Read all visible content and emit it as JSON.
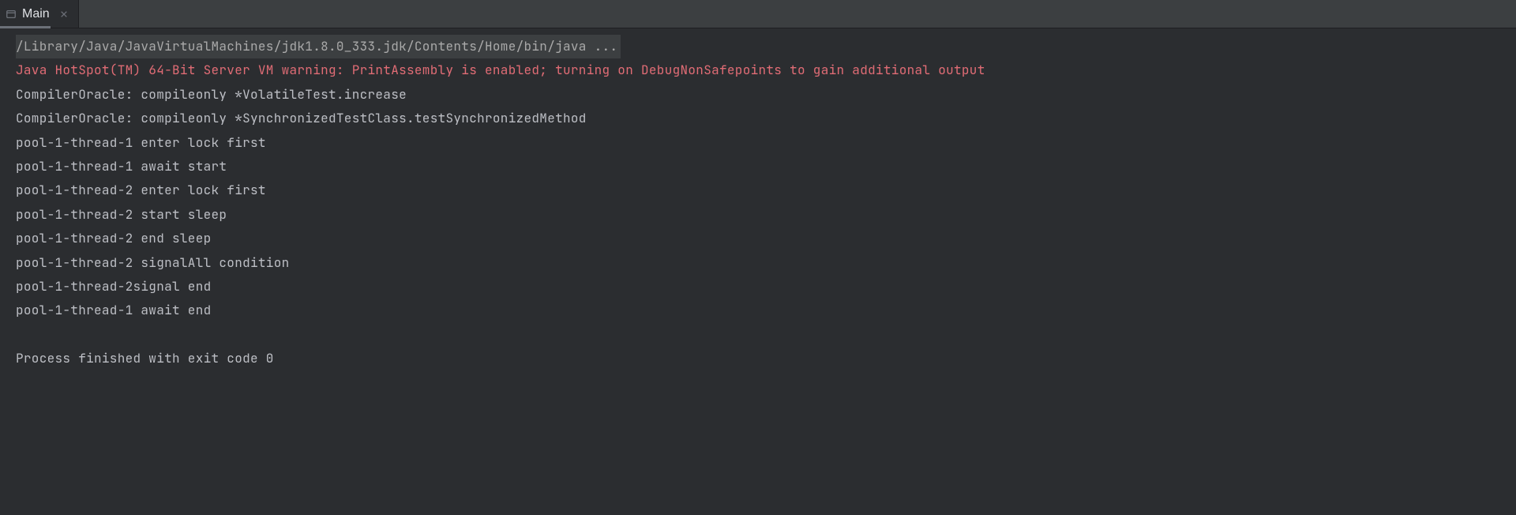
{
  "tab": {
    "label": "Main"
  },
  "console": {
    "command": "/Library/Java/JavaVirtualMachines/jdk1.8.0_333.jdk/Contents/Home/bin/java ...",
    "warning": "Java HotSpot(TM) 64-Bit Server VM warning: PrintAssembly is enabled; turning on DebugNonSafepoints to gain additional output",
    "lines": [
      "CompilerOracle: compileonly *VolatileTest.increase",
      "CompilerOracle: compileonly *SynchronizedTestClass.testSynchronizedMethod",
      "pool-1-thread-1 enter lock first",
      "pool-1-thread-1 await start",
      "pool-1-thread-2 enter lock first",
      "pool-1-thread-2 start sleep",
      "pool-1-thread-2 end sleep",
      "pool-1-thread-2 signalAll condition",
      "pool-1-thread-2signal end",
      "pool-1-thread-1 await end"
    ],
    "exit": "Process finished with exit code 0"
  }
}
